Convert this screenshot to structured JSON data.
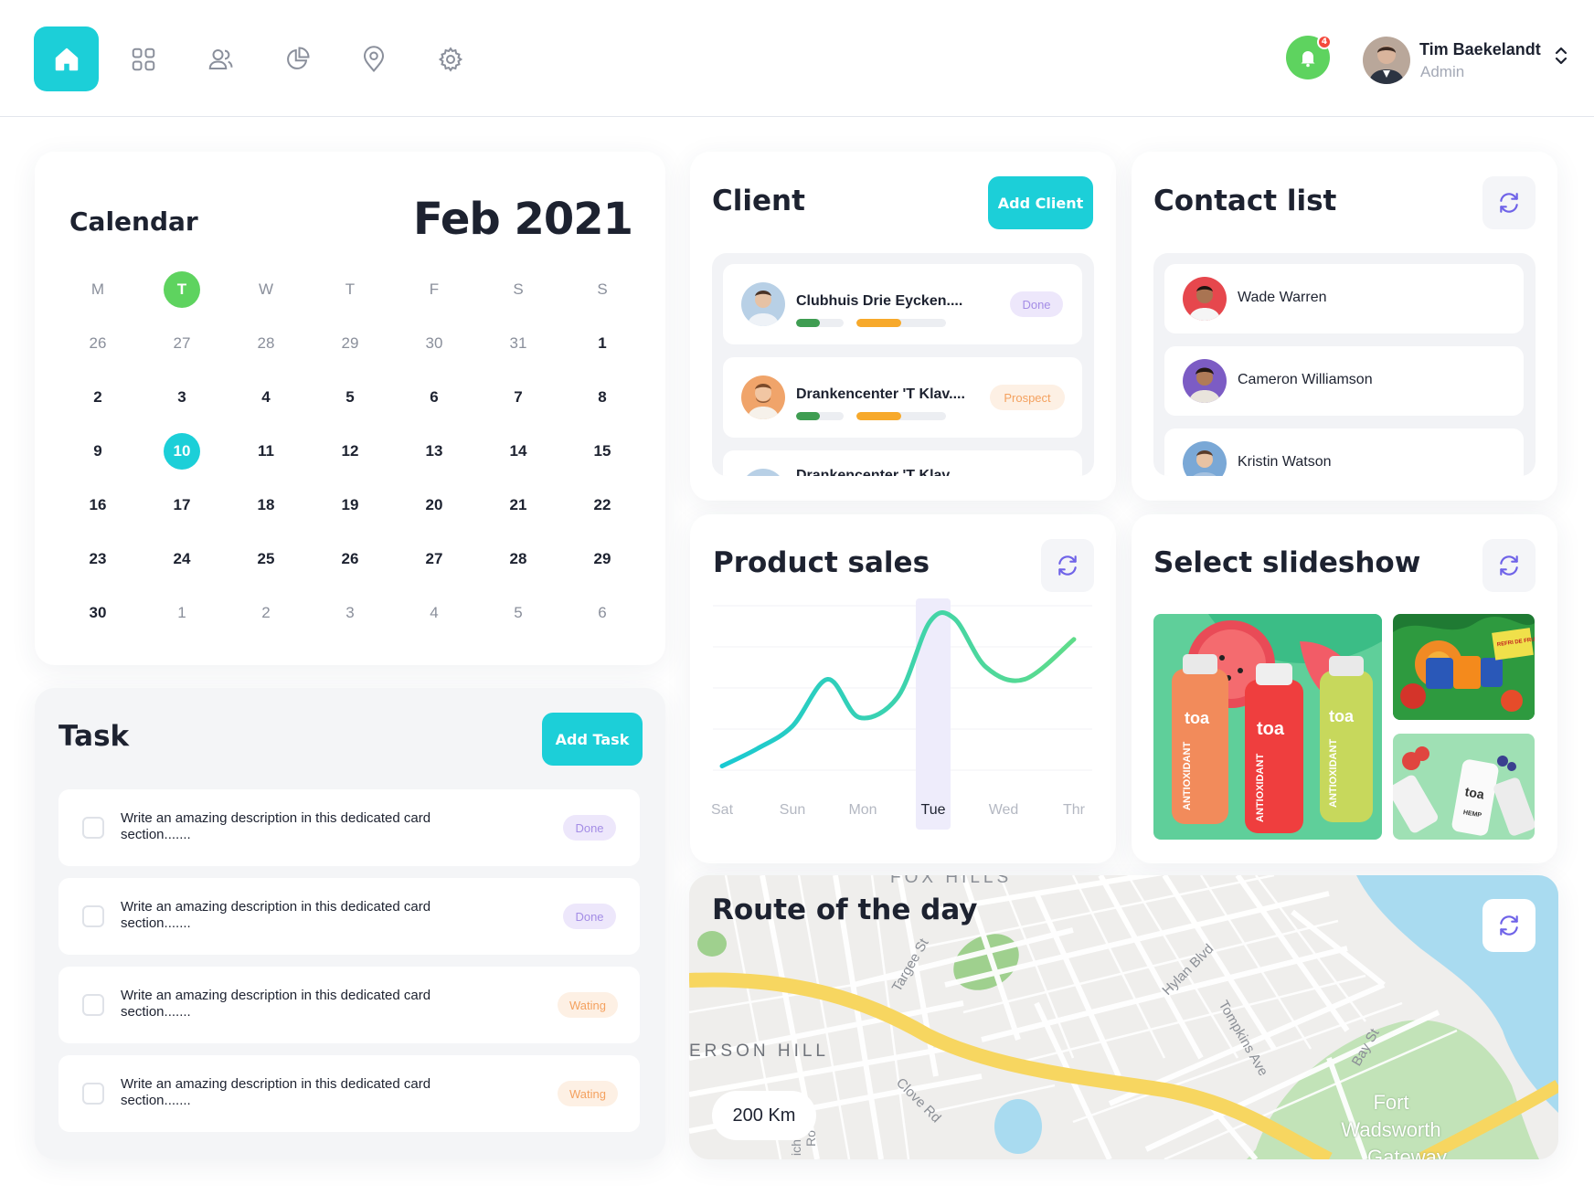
{
  "nav": {
    "items": [
      "home-icon",
      "grid-icon",
      "users-icon",
      "pie-chart-icon",
      "map-pin-icon",
      "gear-icon"
    ],
    "active": "home-icon",
    "accent": "#1ccfd8"
  },
  "notifications": {
    "count": "4",
    "color": "#5ed35f"
  },
  "user": {
    "name": "Tim Baekelandt",
    "role": "Admin"
  },
  "calendar": {
    "title": "Calendar",
    "month": "Feb 2021",
    "weekdays": [
      "M",
      "T",
      "W",
      "T",
      "F",
      "S",
      "S"
    ],
    "today_weekday_index": 1,
    "weeks": [
      [
        "26",
        "27",
        "28",
        "29",
        "30",
        "31",
        "1"
      ],
      [
        "2",
        "3",
        "4",
        "5",
        "6",
        "7",
        "8"
      ],
      [
        "9",
        "10",
        "11",
        "12",
        "13",
        "14",
        "15"
      ],
      [
        "16",
        "17",
        "18",
        "19",
        "20",
        "21",
        "22"
      ],
      [
        "23",
        "24",
        "25",
        "26",
        "27",
        "28",
        "29"
      ],
      [
        "30",
        "1",
        "2",
        "3",
        "4",
        "5",
        "6"
      ]
    ],
    "selected_day": "10"
  },
  "client": {
    "title": "Client",
    "add_label": "Add  Client",
    "rows": [
      {
        "name": "Clubhuis Drie Eycken....",
        "status": "Done",
        "progress_green": 0.5,
        "progress_orange": 0.5
      },
      {
        "name": "Drankencenter 'T Klav....",
        "status": "Prospect",
        "progress_green": 0.5,
        "progress_orange": 0.5
      },
      {
        "name": "Drankencenter 'T Klav....",
        "status": ""
      }
    ]
  },
  "contacts": {
    "title": "Contact list",
    "people": [
      "Wade Warren",
      "Cameron Williamson",
      "Kristin Watson"
    ]
  },
  "task": {
    "title": "Task",
    "add_label": "Add  Task",
    "items": [
      {
        "text": "Write an amazing description in this dedicated card section.......",
        "status": "Done"
      },
      {
        "text": "Write an amazing description in this dedicated card section.......",
        "status": "Done"
      },
      {
        "text": "Write an amazing description in this dedicated card section.......",
        "status": "Wating"
      },
      {
        "text": "Write an amazing description in this dedicated card section.......",
        "status": "Wating"
      }
    ]
  },
  "sales": {
    "title": "Product sales",
    "active_day": "Tue"
  },
  "chart_data": {
    "type": "line",
    "title": "Product sales",
    "x": [
      "Sat",
      "Sun",
      "Mon",
      "Tue",
      "Wed",
      "Thr"
    ],
    "y_points": [
      [
        0.0,
        0.05
      ],
      [
        0.5,
        0.15
      ],
      [
        1.0,
        0.28
      ],
      [
        1.5,
        0.55
      ],
      [
        1.95,
        0.33
      ],
      [
        2.5,
        0.45
      ],
      [
        2.95,
        0.88
      ],
      [
        3.3,
        0.9
      ],
      [
        3.75,
        0.62
      ],
      [
        4.3,
        0.55
      ],
      [
        5.0,
        0.78
      ]
    ],
    "series": [
      {
        "values_note": "",
        "color": "#2bd3b8"
      }
    ],
    "highlight": "Tue",
    "grid": true,
    "ylim": [
      0,
      1
    ]
  },
  "slideshow": {
    "title": "Select slideshow",
    "brand_text": "toa",
    "main_label_1": "ANTIOXIDANT",
    "small_text_1": "REFRI DE FRUTA",
    "small_text_2": "HEMP"
  },
  "route": {
    "title": "Route of the day",
    "distance": "200 Km",
    "labels": {
      "fox_hills": "FOX HILLS",
      "emerson_hill": "ERSON HILL",
      "targee": "Targee St",
      "hylan": "Hylan Blvd",
      "tompkins": "Tompkins Ave",
      "clove": "Clove Rd",
      "bay": "Bay St",
      "fort": "Fort Wadsworth",
      "gateway": "Gateway",
      "richmond": "ich",
      "road_r": "Ro"
    }
  }
}
